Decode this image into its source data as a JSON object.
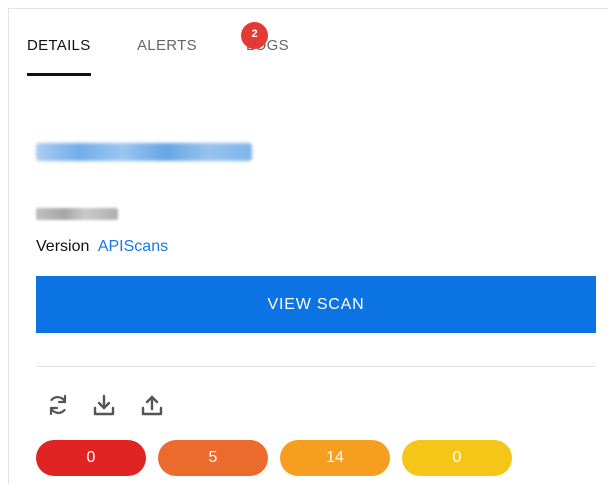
{
  "tabs": [
    {
      "label": "DETAILS",
      "active": true
    },
    {
      "label": "ALERTS",
      "active": false,
      "badge": "2"
    },
    {
      "label": "LOGS",
      "active": false
    }
  ],
  "details": {
    "version_label": "Version",
    "version_link": "APIScans",
    "view_scan_label": "VIEW SCAN"
  },
  "actions": {
    "icons": [
      "refresh-icon",
      "download-icon",
      "upload-icon"
    ]
  },
  "severity_counts": [
    {
      "value": "0",
      "color": "#e02424"
    },
    {
      "value": "5",
      "color": "#ec6a2c"
    },
    {
      "value": "14",
      "color": "#f59e1f"
    },
    {
      "value": "0",
      "color": "#f5c518"
    }
  ],
  "colors": {
    "accent": "#0b73e3",
    "link": "#1877e8",
    "badge": "#e53935"
  }
}
